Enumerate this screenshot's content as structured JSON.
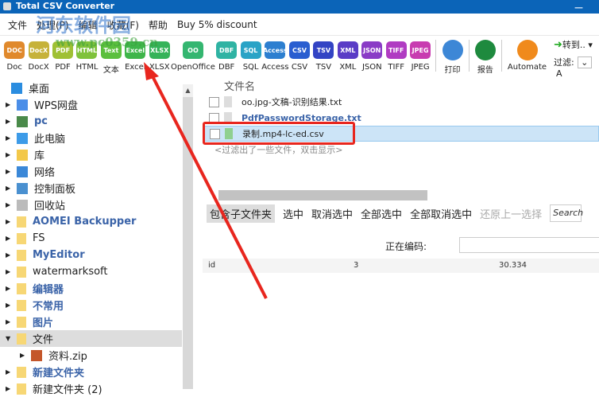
{
  "window": {
    "title": "Total CSV Converter",
    "minimize": "—"
  },
  "watermark": {
    "name": "河东软件园",
    "url": "www.pc0359.cn"
  },
  "menu": [
    "文件",
    "处理(P)",
    "编辑",
    "收藏(F)",
    "帮助",
    "Buy 5% discount"
  ],
  "toolbar": [
    {
      "label": "Doc",
      "icon": "DOC",
      "color": "#e0892c"
    },
    {
      "label": "DocX",
      "icon": "DocX",
      "color": "#c6b23a"
    },
    {
      "label": "PDF",
      "icon": "PDF",
      "color": "#9fc034"
    },
    {
      "label": "HTML",
      "icon": "HTML",
      "color": "#7fc23b"
    },
    {
      "label": "文本",
      "icon": "Text",
      "color": "#5bbf3e"
    },
    {
      "label": "Excel",
      "icon": "Excel",
      "color": "#3fb54a"
    },
    {
      "label": "XLSX",
      "icon": "XLSX",
      "color": "#36b35a"
    },
    {
      "label": "OpenOffice",
      "icon": "OO",
      "color": "#34b670"
    },
    {
      "label": "DBF",
      "icon": "DBF",
      "color": "#2fb3a3"
    },
    {
      "label": "SQL",
      "icon": "SQL",
      "color": "#2aa3c6"
    },
    {
      "label": "Access",
      "icon": "Access",
      "color": "#2d7fd0"
    },
    {
      "label": "CSV",
      "icon": "CSV",
      "color": "#2a5ed0"
    },
    {
      "label": "TSV",
      "icon": "TSV",
      "color": "#3344c4"
    },
    {
      "label": "XML",
      "icon": "XML",
      "color": "#5a3cc6"
    },
    {
      "label": "JSON",
      "icon": "JSON",
      "color": "#8a3cc6"
    },
    {
      "label": "TIFF",
      "icon": "TIFF",
      "color": "#b03cc2"
    },
    {
      "label": "JPEG",
      "icon": "JPEG",
      "color": "#c83cb0"
    }
  ],
  "actions": {
    "print": "打印",
    "report": "报告",
    "automate": "Automate",
    "goto": "转到..",
    "filter": "过滤:",
    "filter_value": "A"
  },
  "tree": [
    {
      "label": "桌面",
      "icon": "desktop-icon",
      "style": "",
      "exp": ""
    },
    {
      "label": "WPS网盘",
      "icon": "cloud-icon",
      "style": "",
      "exp": "▶"
    },
    {
      "label": "pc",
      "icon": "user-icon",
      "style": "blue",
      "exp": "▶"
    },
    {
      "label": "此电脑",
      "icon": "computer-icon",
      "style": "",
      "exp": "▶"
    },
    {
      "label": "库",
      "icon": "library-icon",
      "style": "",
      "exp": "▶"
    },
    {
      "label": "网络",
      "icon": "network-icon",
      "style": "",
      "exp": "▶"
    },
    {
      "label": "控制面板",
      "icon": "control-panel-icon",
      "style": "",
      "exp": "▶"
    },
    {
      "label": "回收站",
      "icon": "recycle-bin-icon",
      "style": "",
      "exp": "▶"
    },
    {
      "label": "AOMEI Backupper",
      "icon": "folder-icon",
      "style": "blue",
      "exp": "▶"
    },
    {
      "label": "FS",
      "icon": "folder-icon",
      "style": "",
      "exp": "▶"
    },
    {
      "label": "MyEditor",
      "icon": "folder-icon",
      "style": "blue",
      "exp": "▶"
    },
    {
      "label": "watermarksoft",
      "icon": "folder-icon",
      "style": "",
      "exp": "▶"
    },
    {
      "label": "编辑器",
      "icon": "folder-icon",
      "style": "blue",
      "exp": "▶"
    },
    {
      "label": "不常用",
      "icon": "folder-icon",
      "style": "blue",
      "exp": "▶"
    },
    {
      "label": "图片",
      "icon": "folder-icon",
      "style": "blue",
      "exp": "▶"
    },
    {
      "label": "文件",
      "icon": "folder-icon",
      "style": "sel",
      "exp": "▼"
    },
    {
      "label": "资料.zip",
      "icon": "zip-icon",
      "style": "child",
      "exp": "▶"
    },
    {
      "label": "新建文件夹",
      "icon": "folder-icon",
      "style": "blue",
      "exp": "▶"
    },
    {
      "label": "新建文件夹 (2)",
      "icon": "folder-icon",
      "style": "",
      "exp": "▶"
    }
  ],
  "files": {
    "header": "文件名",
    "items": [
      {
        "name": "oo.jpg-文稿-识别结果.txt",
        "style": ""
      },
      {
        "name": "PdfPasswordStorage.txt",
        "style": "blue"
      },
      {
        "name": "录制.mp4-lc-ed.csv",
        "style": "sel"
      }
    ],
    "hint": "<过滤出了一些文件，双击显示>"
  },
  "selection_bar": [
    "包含子文件夹",
    "选中",
    "取消选中",
    "全部选中",
    "全部取消选中",
    "还原上一选择"
  ],
  "search_placeholder": "Search",
  "encoding_label": "正在编码:",
  "table_row": [
    "id",
    "3",
    "30.334"
  ]
}
